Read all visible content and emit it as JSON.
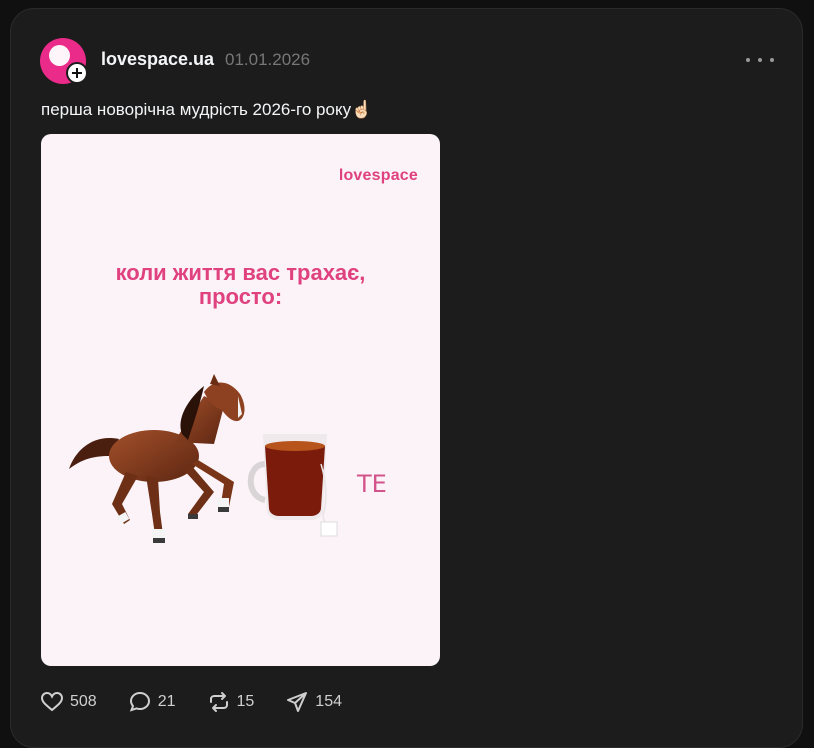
{
  "post": {
    "username": "lovespace.ua",
    "date": "01.01.2026",
    "caption": "перша новорічна мудрість 2026-го року☝🏻"
  },
  "image": {
    "brand": "lovespace",
    "headline_line1": "коли життя вас трахає,",
    "headline_line2": "просто:",
    "tea_label": "ТЕ"
  },
  "actions": {
    "likes": "508",
    "comments": "21",
    "reposts": "15",
    "shares": "154"
  },
  "colors": {
    "accent": "#ea2b8a",
    "brand_text": "#e0417f",
    "card_bg": "#1c1c1c",
    "page_bg": "#101010"
  },
  "icons": [
    "plus-icon",
    "more-icon",
    "heart-icon",
    "comment-icon",
    "repost-icon",
    "share-icon"
  ]
}
